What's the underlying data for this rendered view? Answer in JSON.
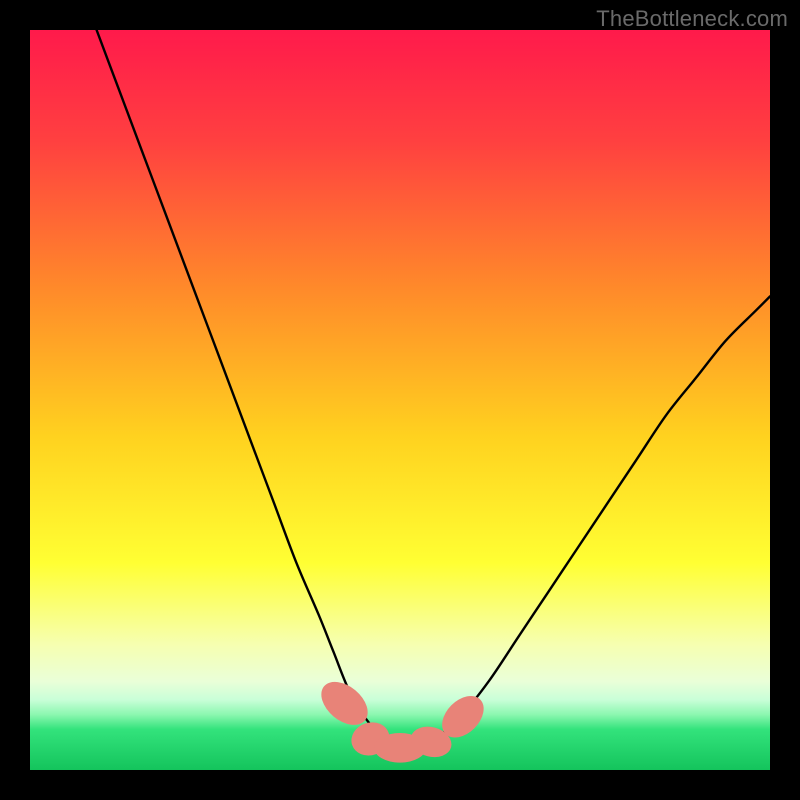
{
  "watermark": "TheBottleneck.com",
  "colors": {
    "black": "#000000",
    "curve": "#000000",
    "marker_fill": "#e88378",
    "marker_stroke": "#cf6c63",
    "green_band_top": "#2fe77a",
    "green_band_bottom": "#18c860"
  },
  "chart_data": {
    "type": "line",
    "title": "",
    "xlabel": "",
    "ylabel": "",
    "xlim": [
      0,
      100
    ],
    "ylim": [
      0,
      100
    ],
    "grid": false,
    "legend": false,
    "gradient_stops": [
      {
        "offset": 0.0,
        "color": "#ff1a4b"
      },
      {
        "offset": 0.15,
        "color": "#ff4040"
      },
      {
        "offset": 0.35,
        "color": "#ff8a2a"
      },
      {
        "offset": 0.55,
        "color": "#ffd21f"
      },
      {
        "offset": 0.72,
        "color": "#ffff33"
      },
      {
        "offset": 0.83,
        "color": "#f6ffb0"
      },
      {
        "offset": 0.88,
        "color": "#eaffd8"
      },
      {
        "offset": 0.905,
        "color": "#c9ffd8"
      },
      {
        "offset": 0.925,
        "color": "#8cf7b0"
      },
      {
        "offset": 0.945,
        "color": "#33e37c"
      },
      {
        "offset": 1.0,
        "color": "#14c45c"
      }
    ],
    "series": [
      {
        "name": "bottleneck-curve",
        "x": [
          9,
          12,
          15,
          18,
          21,
          24,
          27,
          30,
          33,
          36,
          39,
          41,
          43,
          45,
          47,
          49,
          51,
          53,
          55,
          58,
          62,
          66,
          70,
          74,
          78,
          82,
          86,
          90,
          94,
          98,
          100
        ],
        "y": [
          100,
          92,
          84,
          76,
          68,
          60,
          52,
          44,
          36,
          28,
          21,
          16,
          11,
          7.5,
          5,
          3.5,
          3,
          3.3,
          4.3,
          7,
          12,
          18,
          24,
          30,
          36,
          42,
          48,
          53,
          58,
          62,
          64
        ]
      }
    ],
    "markers": [
      {
        "x": 42.5,
        "y": 9,
        "rx": 2.3,
        "ry": 3.6,
        "rot": -50
      },
      {
        "x": 46.0,
        "y": 4.2,
        "rx": 2.6,
        "ry": 2.2,
        "rot": -18
      },
      {
        "x": 50.0,
        "y": 3.0,
        "rx": 3.5,
        "ry": 2.0,
        "rot": 0
      },
      {
        "x": 54.2,
        "y": 3.8,
        "rx": 2.8,
        "ry": 2.0,
        "rot": 15
      },
      {
        "x": 58.5,
        "y": 7.2,
        "rx": 2.2,
        "ry": 3.3,
        "rot": 45
      }
    ]
  }
}
